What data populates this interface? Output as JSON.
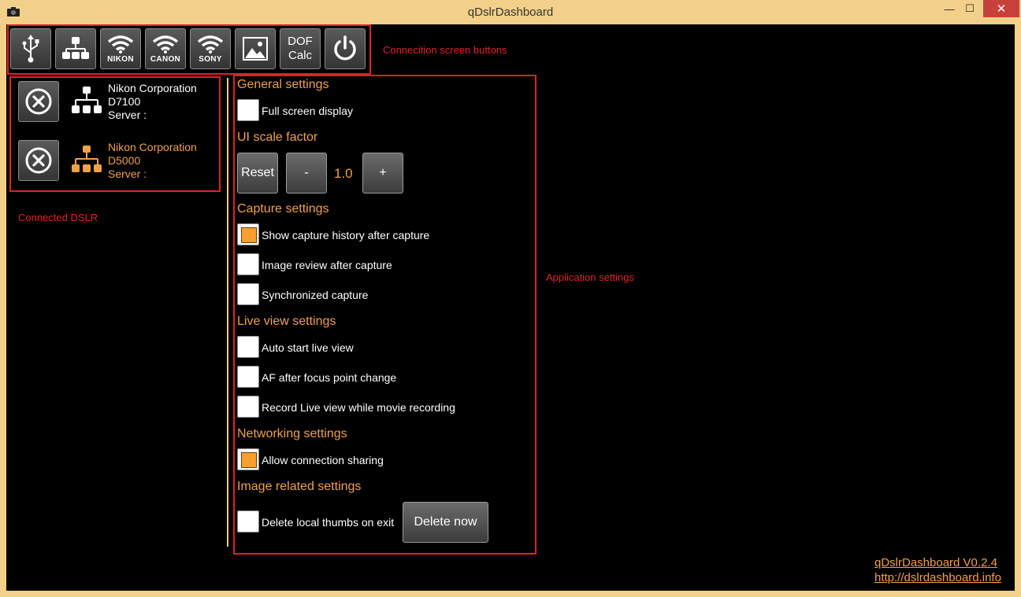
{
  "window": {
    "title": "qDslrDashboard",
    "min_glyph": "—",
    "max_glyph": "☐",
    "close_glyph": "✕"
  },
  "toolbar": {
    "buttons": [
      {
        "icon": "usb-icon",
        "label": ""
      },
      {
        "icon": "network-icon",
        "label": ""
      },
      {
        "icon": "wifi-icon",
        "label": "NIKON"
      },
      {
        "icon": "wifi-icon",
        "label": "CANON"
      },
      {
        "icon": "wifi-icon",
        "label": "SONY"
      },
      {
        "icon": "image-icon",
        "label": ""
      },
      {
        "icon": "",
        "label_line1": "DOF",
        "label_line2": "Calc"
      },
      {
        "icon": "power-icon",
        "label": ""
      }
    ]
  },
  "annotations": {
    "connection_buttons": "Connecition screen buttons",
    "connected_dslr": "Connected DSLR",
    "application_settings": "Application settings"
  },
  "connected": [
    {
      "vendor": "Nikon Corporation",
      "model": "D7100",
      "server": "Server :",
      "color": "#ffffff"
    },
    {
      "vendor": "Nikon Corporation",
      "model": "D5000",
      "server": "Server :",
      "color": "#f0a04b"
    }
  ],
  "settings": {
    "general_header": "General settings",
    "full_screen": {
      "label": "Full screen display",
      "checked": false
    },
    "ui_scale_header": "UI scale factor",
    "reset_label": "Reset",
    "minus_label": "-",
    "scale_value": "1.0",
    "plus_label": "+",
    "capture_header": "Capture settings",
    "show_history": {
      "label": "Show capture history after capture",
      "checked": true
    },
    "image_review": {
      "label": "Image review after capture",
      "checked": false
    },
    "sync_capture": {
      "label": "Synchronized capture",
      "checked": false
    },
    "liveview_header": "Live view settings",
    "auto_liveview": {
      "label": "Auto start live view",
      "checked": false
    },
    "af_focus": {
      "label": "AF after focus point change",
      "checked": false
    },
    "record_lv": {
      "label": "Record Live view while movie recording",
      "checked": false
    },
    "networking_header": "Networking settings",
    "conn_sharing": {
      "label": "Allow connection sharing",
      "checked": true
    },
    "image_header": "Image related settings",
    "delete_thumbs": {
      "label": "Delete local thumbs on exit",
      "checked": false
    },
    "delete_now_label": "Delete now"
  },
  "footer": {
    "version": "qDslrDashboard V0.2.4",
    "url": "http://dslrdashboard.info"
  },
  "colors": {
    "accent": "#f0a04b",
    "annotation": "#e0202a",
    "frame": "#f3d08a"
  }
}
